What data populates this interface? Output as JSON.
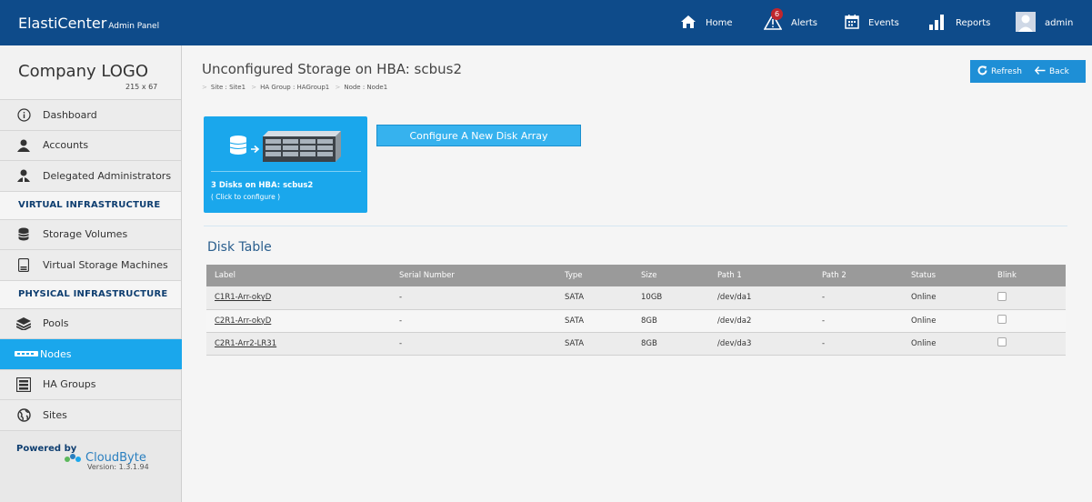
{
  "brand": {
    "name": "ElastiCenter",
    "sub": "Admin Panel"
  },
  "topnav": {
    "home": "Home",
    "alerts": "Alerts",
    "alerts_count": "6",
    "events": "Events",
    "reports": "Reports",
    "user": "admin"
  },
  "logo": {
    "title": "Company LOGO",
    "size": "215 x 67"
  },
  "sidebar": {
    "items": [
      {
        "label": "Dashboard",
        "icon": "info-icon"
      },
      {
        "label": "Accounts",
        "icon": "user-icon"
      },
      {
        "label": "Delegated Administrators",
        "icon": "admin-user-icon"
      }
    ],
    "virtual_heading": "VIRTUAL INFRASTRUCTURE",
    "virtual_items": [
      {
        "label": "Storage Volumes",
        "icon": "database-icon"
      },
      {
        "label": "Virtual Storage Machines",
        "icon": "storage-machine-icon"
      }
    ],
    "physical_heading": "PHYSICAL INFRASTRUCTURE",
    "physical_items": [
      {
        "label": "Pools",
        "icon": "layers-icon"
      },
      {
        "label": "Nodes",
        "icon": "node-icon",
        "active": true
      },
      {
        "label": "HA Groups",
        "icon": "ha-group-icon"
      },
      {
        "label": "Sites",
        "icon": "globe-icon"
      }
    ],
    "powered_by": "Powered by",
    "cloudbyte": "CloudByte",
    "version": "Version: 1.3.1.94"
  },
  "page": {
    "title": "Unconfigured Storage on HBA: scbus2",
    "breadcrumb": [
      "Site : Site1",
      "HA Group : HAGroup1",
      "Node : Node1"
    ],
    "refresh": "Refresh",
    "back": "Back"
  },
  "hba_tile": {
    "title": "3 Disks on HBA: scbus2",
    "subtitle": "( Click to configure )"
  },
  "configure_button": "Configure A New Disk Array",
  "disk_table": {
    "title": "Disk Table",
    "headers": [
      "Label",
      "Serial Number",
      "Type",
      "Size",
      "Path 1",
      "Path 2",
      "Status",
      "Blink"
    ],
    "rows": [
      [
        "C1R1-Arr-okyD",
        "-",
        "SATA",
        "10GB",
        "/dev/da1",
        "-",
        "Online"
      ],
      [
        "C2R1-Arr-okyD",
        "-",
        "SATA",
        "8GB",
        "/dev/da2",
        "-",
        "Online"
      ],
      [
        "C2R1-Arr2-LR31",
        "-",
        "SATA",
        "8GB",
        "/dev/da3",
        "-",
        "Online"
      ]
    ]
  },
  "colors": {
    "topbar": "#0e4b8a",
    "accent": "#1aa7ec",
    "table_header": "#9a9a9a"
  }
}
